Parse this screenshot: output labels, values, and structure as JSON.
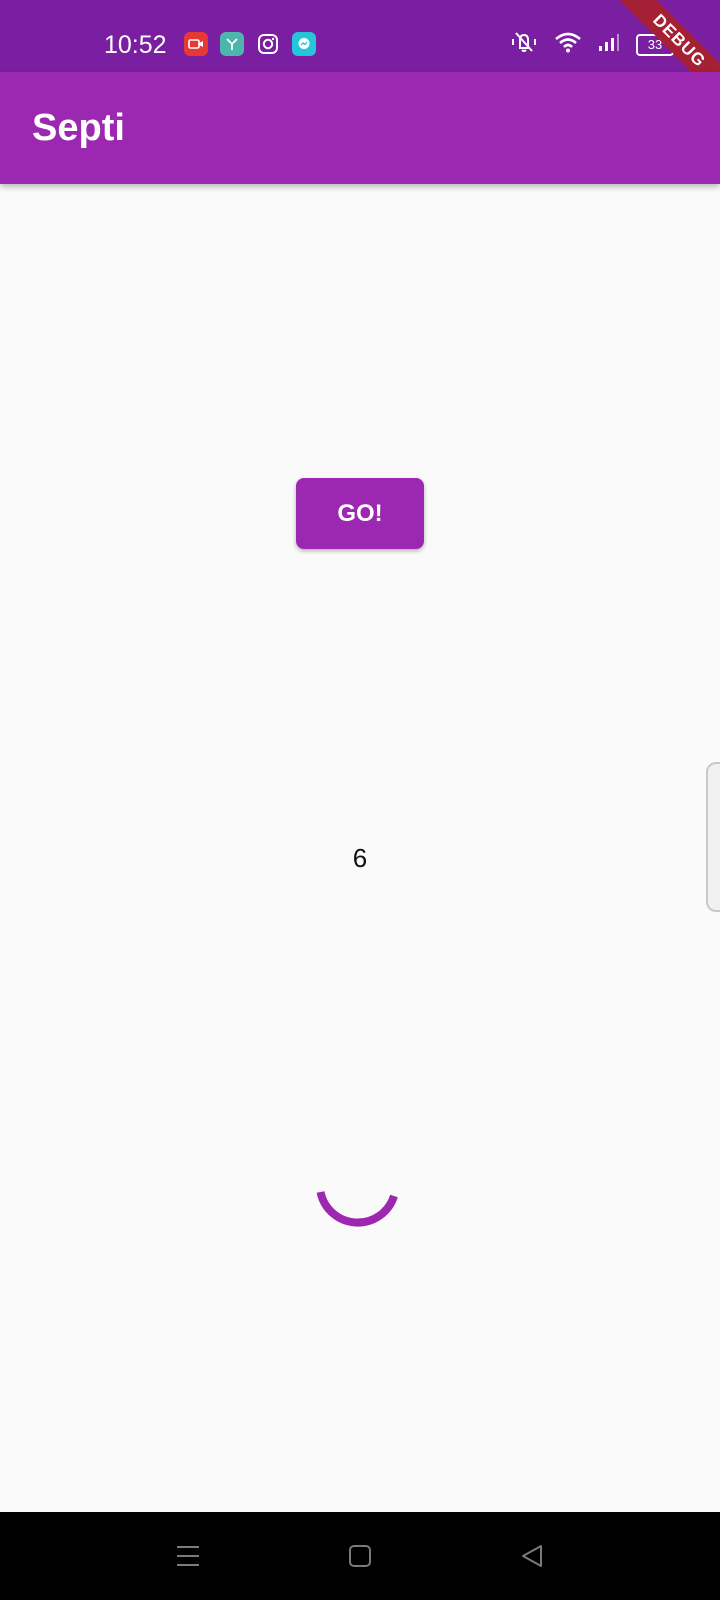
{
  "status_bar": {
    "time": "10:52",
    "notification_icons": [
      "screen-recorder-icon",
      "app-icon",
      "instagram-icon",
      "messenger-icon"
    ],
    "system_icons": [
      "vibrate-off-icon",
      "wifi-icon",
      "signal-icon",
      "battery-icon"
    ],
    "battery_level": "33",
    "debug_label": "DEBUG"
  },
  "app_bar": {
    "title": "Septi"
  },
  "main": {
    "go_label": "GO!",
    "counter": "6",
    "spinner_icon": "loading-spinner-icon"
  },
  "nav_bar": {
    "buttons": [
      "menu-icon",
      "home-icon",
      "back-icon"
    ]
  },
  "colors": {
    "primary": "#9c27b0",
    "primary_dark": "#7b1fa2",
    "background": "#fafafa",
    "debug_banner": "#a52034"
  }
}
